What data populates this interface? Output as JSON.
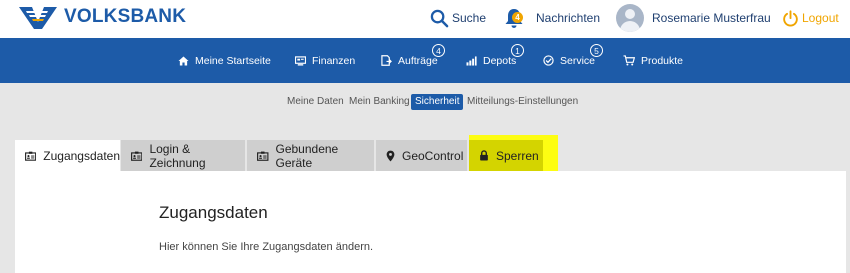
{
  "header": {
    "brand": "VOLKSBANK",
    "search_label": "Suche",
    "notifications_label": "Nachrichten",
    "notifications_count": "4",
    "user_name": "Rosemarie Musterfrau",
    "logout_label": "Logout"
  },
  "nav": {
    "items": [
      {
        "label": "Meine Startseite",
        "icon": "home-icon"
      },
      {
        "label": "Finanzen",
        "icon": "finance-icon"
      },
      {
        "label": "Aufträge",
        "icon": "orders-icon",
        "badge": "4"
      },
      {
        "label": "Depots",
        "icon": "chart-icon",
        "badge": "1"
      },
      {
        "label": "Service",
        "icon": "check-circle-icon",
        "badge": "5"
      },
      {
        "label": "Produkte",
        "icon": "cart-icon"
      }
    ]
  },
  "subnav": {
    "items": [
      "Meine Daten",
      "Mein Banking",
      "Sicherheit",
      "Mitteilungs-Einstellungen"
    ],
    "active": "Sicherheit"
  },
  "tabs": [
    {
      "label": "Zugangsdaten",
      "icon": "id-card-icon",
      "active": true
    },
    {
      "label": "Login & Zeichnung",
      "icon": "id-card-icon"
    },
    {
      "label": "Gebundene Geräte",
      "icon": "id-card-icon"
    },
    {
      "label": "GeoControl",
      "icon": "map-pin-icon"
    },
    {
      "label": "Sperren",
      "icon": "lock-icon",
      "highlight": "#ffff00"
    }
  ],
  "content": {
    "title": "Zugangsdaten",
    "description": "Hier können Sie Ihre Zugangsdaten ändern."
  },
  "colors": {
    "brand_blue": "#1d5ba8",
    "accent_orange": "#f0a500",
    "highlight_yellow": "#ffff00"
  }
}
